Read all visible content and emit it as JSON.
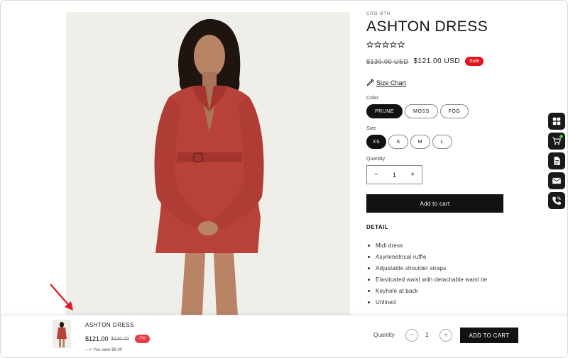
{
  "product": {
    "sku": "CRO-BTN",
    "title": "ASHTON DRESS",
    "rating_stars": 5,
    "old_price": "$130.00 USD",
    "new_price": "$121.00 USD",
    "sale_badge": "Sale",
    "size_chart_label": "Size Chart",
    "color_label": "Color",
    "colors": [
      "PRUNE",
      "MOSS",
      "FOG"
    ],
    "selected_color": "PRUNE",
    "size_label": "Size",
    "sizes": [
      "XS",
      "S",
      "M",
      "L"
    ],
    "selected_size": "XS",
    "quantity_label": "Quantity",
    "quantity": "1",
    "minus": "−",
    "plus": "+",
    "add_to_cart": "Add to cart",
    "detail_heading": "DETAIL",
    "details": [
      "Midi dress",
      "Asymmetrical ruffle",
      "Adjustable shoulder straps",
      "Elasticated waist with detachable waist tie",
      "Keyhole at back",
      "Unlined"
    ]
  },
  "sticky_bar": {
    "title": "ASHTON DRESS",
    "price": "$121.00",
    "old_price": "$130.00",
    "discount_badge": "-7%",
    "savings": "—> You save $9.00",
    "quantity_label": "Quantity",
    "quantity": "1",
    "minus": "−",
    "plus": "+",
    "add_to_cart": "ADD TO CART"
  },
  "floating_actions": [
    "grid-icon",
    "cart-icon",
    "document-icon",
    "mail-icon",
    "phone-icon"
  ],
  "colors": {
    "accent_dark": "#121212",
    "sale_red": "#e2141e",
    "dress_red": "#b8423a",
    "arrow_red": "#e2141e",
    "cart_dot": "#3cc43c"
  }
}
